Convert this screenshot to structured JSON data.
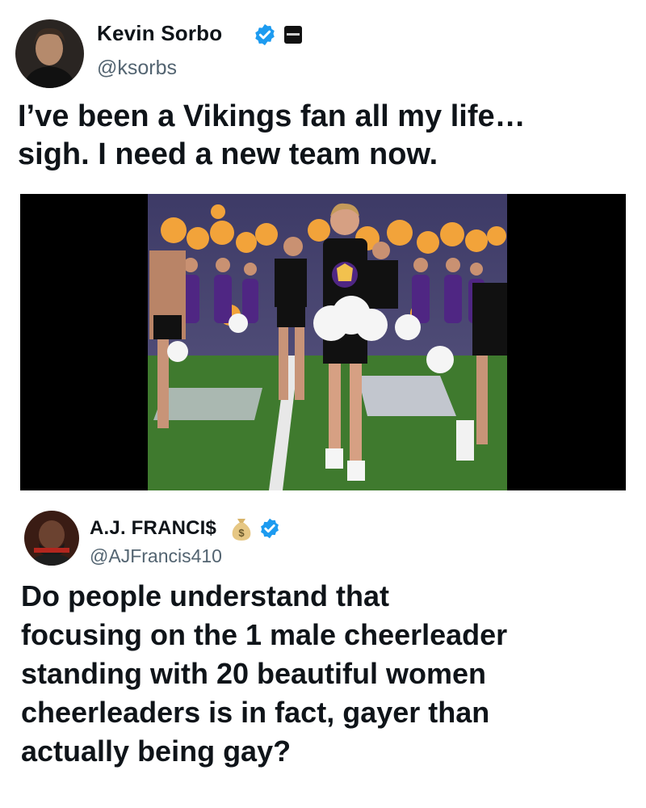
{
  "tweet1": {
    "name": "Kevin Sorbo",
    "handle": "@ksorbs",
    "text_lines": [
      "I’ve been a Vikings fan all my life…",
      "sigh. I need a new team now."
    ],
    "badge_icons": [
      "verified-check-icon",
      "affiliate-badge-icon"
    ]
  },
  "media": {
    "alt": "Vikings cheerleaders with one male cheerleader in front, on football field"
  },
  "tweet2": {
    "name": "A.J. FRANCI$",
    "handle": "@AJFrancis410",
    "text_lines": [
      "Do people understand that",
      "focusing on the 1 male cheerleader",
      "standing with 20 beautiful women",
      "cheerleaders is in fact, gayer than",
      "actually being gay?"
    ],
    "badge_icons": [
      "money-bag-icon",
      "verified-check-icon"
    ]
  },
  "colors": {
    "verified_blue": "#1d9bf0",
    "field_green": "#3f7a2e",
    "vikings_purple": "#4f2683",
    "pom_gold": "#f2a33a"
  }
}
